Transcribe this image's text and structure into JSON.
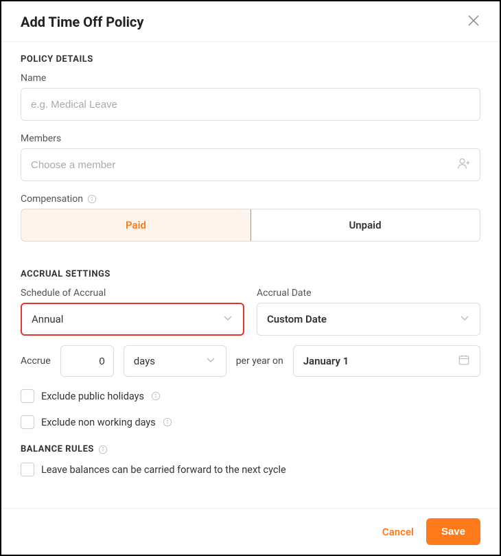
{
  "header": {
    "title": "Add Time Off Policy"
  },
  "policy_details": {
    "section": "POLICY DETAILS",
    "name_label": "Name",
    "name_placeholder": "e.g. Medical Leave",
    "name_value": "",
    "members_label": "Members",
    "members_placeholder": "Choose a member",
    "members_value": "",
    "compensation_label": "Compensation",
    "paid_label": "Paid",
    "unpaid_label": "Unpaid",
    "compensation_selected": "Paid"
  },
  "accrual": {
    "section": "ACCRUAL SETTINGS",
    "schedule_label": "Schedule of Accrual",
    "schedule_value": "Annual",
    "date_label": "Accrual Date",
    "date_value": "Custom Date",
    "accrue_label": "Accrue",
    "accrue_amount": "0",
    "accrue_unit": "days",
    "per_year_label": "per year on",
    "per_year_date": "January 1",
    "exclude_holidays": "Exclude public holidays",
    "exclude_nonworking": "Exclude non working days"
  },
  "balance": {
    "section": "BALANCE RULES",
    "carry_forward": "Leave balances can be carried forward to the next cycle"
  },
  "footer": {
    "cancel": "Cancel",
    "save": "Save"
  }
}
